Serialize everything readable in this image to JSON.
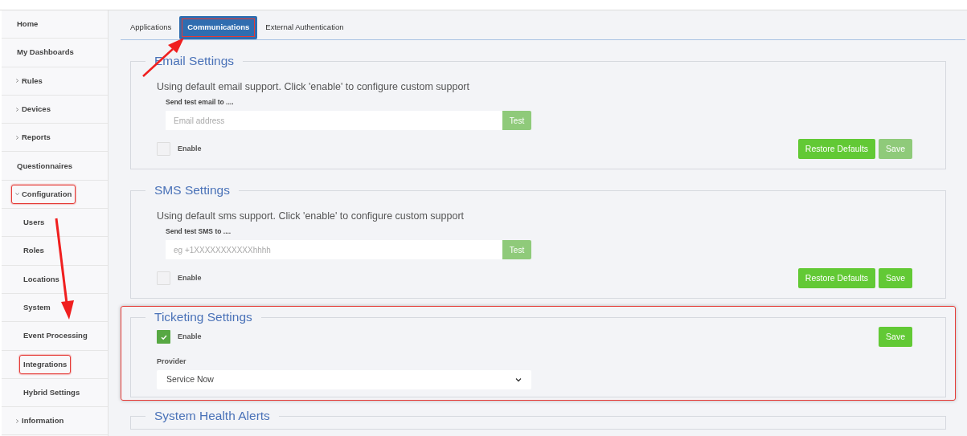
{
  "sidebar": {
    "items": [
      {
        "label": "Home",
        "kind": "link",
        "highlighted": false
      },
      {
        "label": "My Dashboards",
        "kind": "link",
        "highlighted": false
      },
      {
        "label": "Rules",
        "kind": "group",
        "expanded": false,
        "highlighted": false
      },
      {
        "label": "Devices",
        "kind": "group",
        "expanded": false,
        "highlighted": false
      },
      {
        "label": "Reports",
        "kind": "group",
        "expanded": false,
        "highlighted": false
      },
      {
        "label": "Questionnaires",
        "kind": "link",
        "highlighted": false
      },
      {
        "label": "Configuration",
        "kind": "group",
        "expanded": true,
        "highlighted": true
      },
      {
        "label": "Users",
        "kind": "sub",
        "highlighted": false
      },
      {
        "label": "Roles",
        "kind": "sub",
        "highlighted": false
      },
      {
        "label": "Locations",
        "kind": "sub",
        "highlighted": false
      },
      {
        "label": "System",
        "kind": "sub",
        "highlighted": false
      },
      {
        "label": "Event Processing",
        "kind": "sub",
        "highlighted": false
      },
      {
        "label": "Integrations",
        "kind": "sub",
        "highlighted": true
      },
      {
        "label": "Hybrid Settings",
        "kind": "sub",
        "highlighted": false
      },
      {
        "label": "Information",
        "kind": "group",
        "expanded": false,
        "highlighted": false
      }
    ]
  },
  "tabs": [
    {
      "label": "Applications",
      "selected": false,
      "highlighted": false
    },
    {
      "label": "Communications",
      "selected": true,
      "highlighted": true
    },
    {
      "label": "External Authentication",
      "selected": false,
      "highlighted": false
    }
  ],
  "sections": [
    {
      "kind": "test",
      "title": "Email Settings",
      "highlighted": false,
      "description": "Using default email support. Click 'enable' to configure custom support",
      "test_label": "Send test email to ....",
      "placeholder": "Email address",
      "test_button": {
        "label": "Test",
        "disabled": true
      },
      "enable_label": "Enable",
      "enabled": false,
      "buttons": [
        {
          "label": "Restore Defaults",
          "disabled": false
        },
        {
          "label": "Save",
          "disabled": true
        }
      ]
    },
    {
      "kind": "test",
      "title": "SMS Settings",
      "highlighted": false,
      "description": "Using default sms support. Click 'enable' to configure custom support",
      "test_label": "Send test SMS to ....",
      "placeholder": "eg +1XXXXXXXXXXXhhhh",
      "test_button": {
        "label": "Test",
        "disabled": true
      },
      "enable_label": "Enable",
      "enabled": false,
      "buttons": [
        {
          "label": "Restore Defaults",
          "disabled": false
        },
        {
          "label": "Save",
          "disabled": false
        }
      ]
    },
    {
      "kind": "ticketing",
      "title": "Ticketing Settings",
      "highlighted": true,
      "enable_label": "Enable",
      "enabled": true,
      "buttons": [
        {
          "label": "Save",
          "disabled": false
        }
      ],
      "provider_label": "Provider",
      "provider_value": "Service Now"
    },
    {
      "kind": "cut",
      "title": "System Health Alerts",
      "highlighted": false
    }
  ]
}
